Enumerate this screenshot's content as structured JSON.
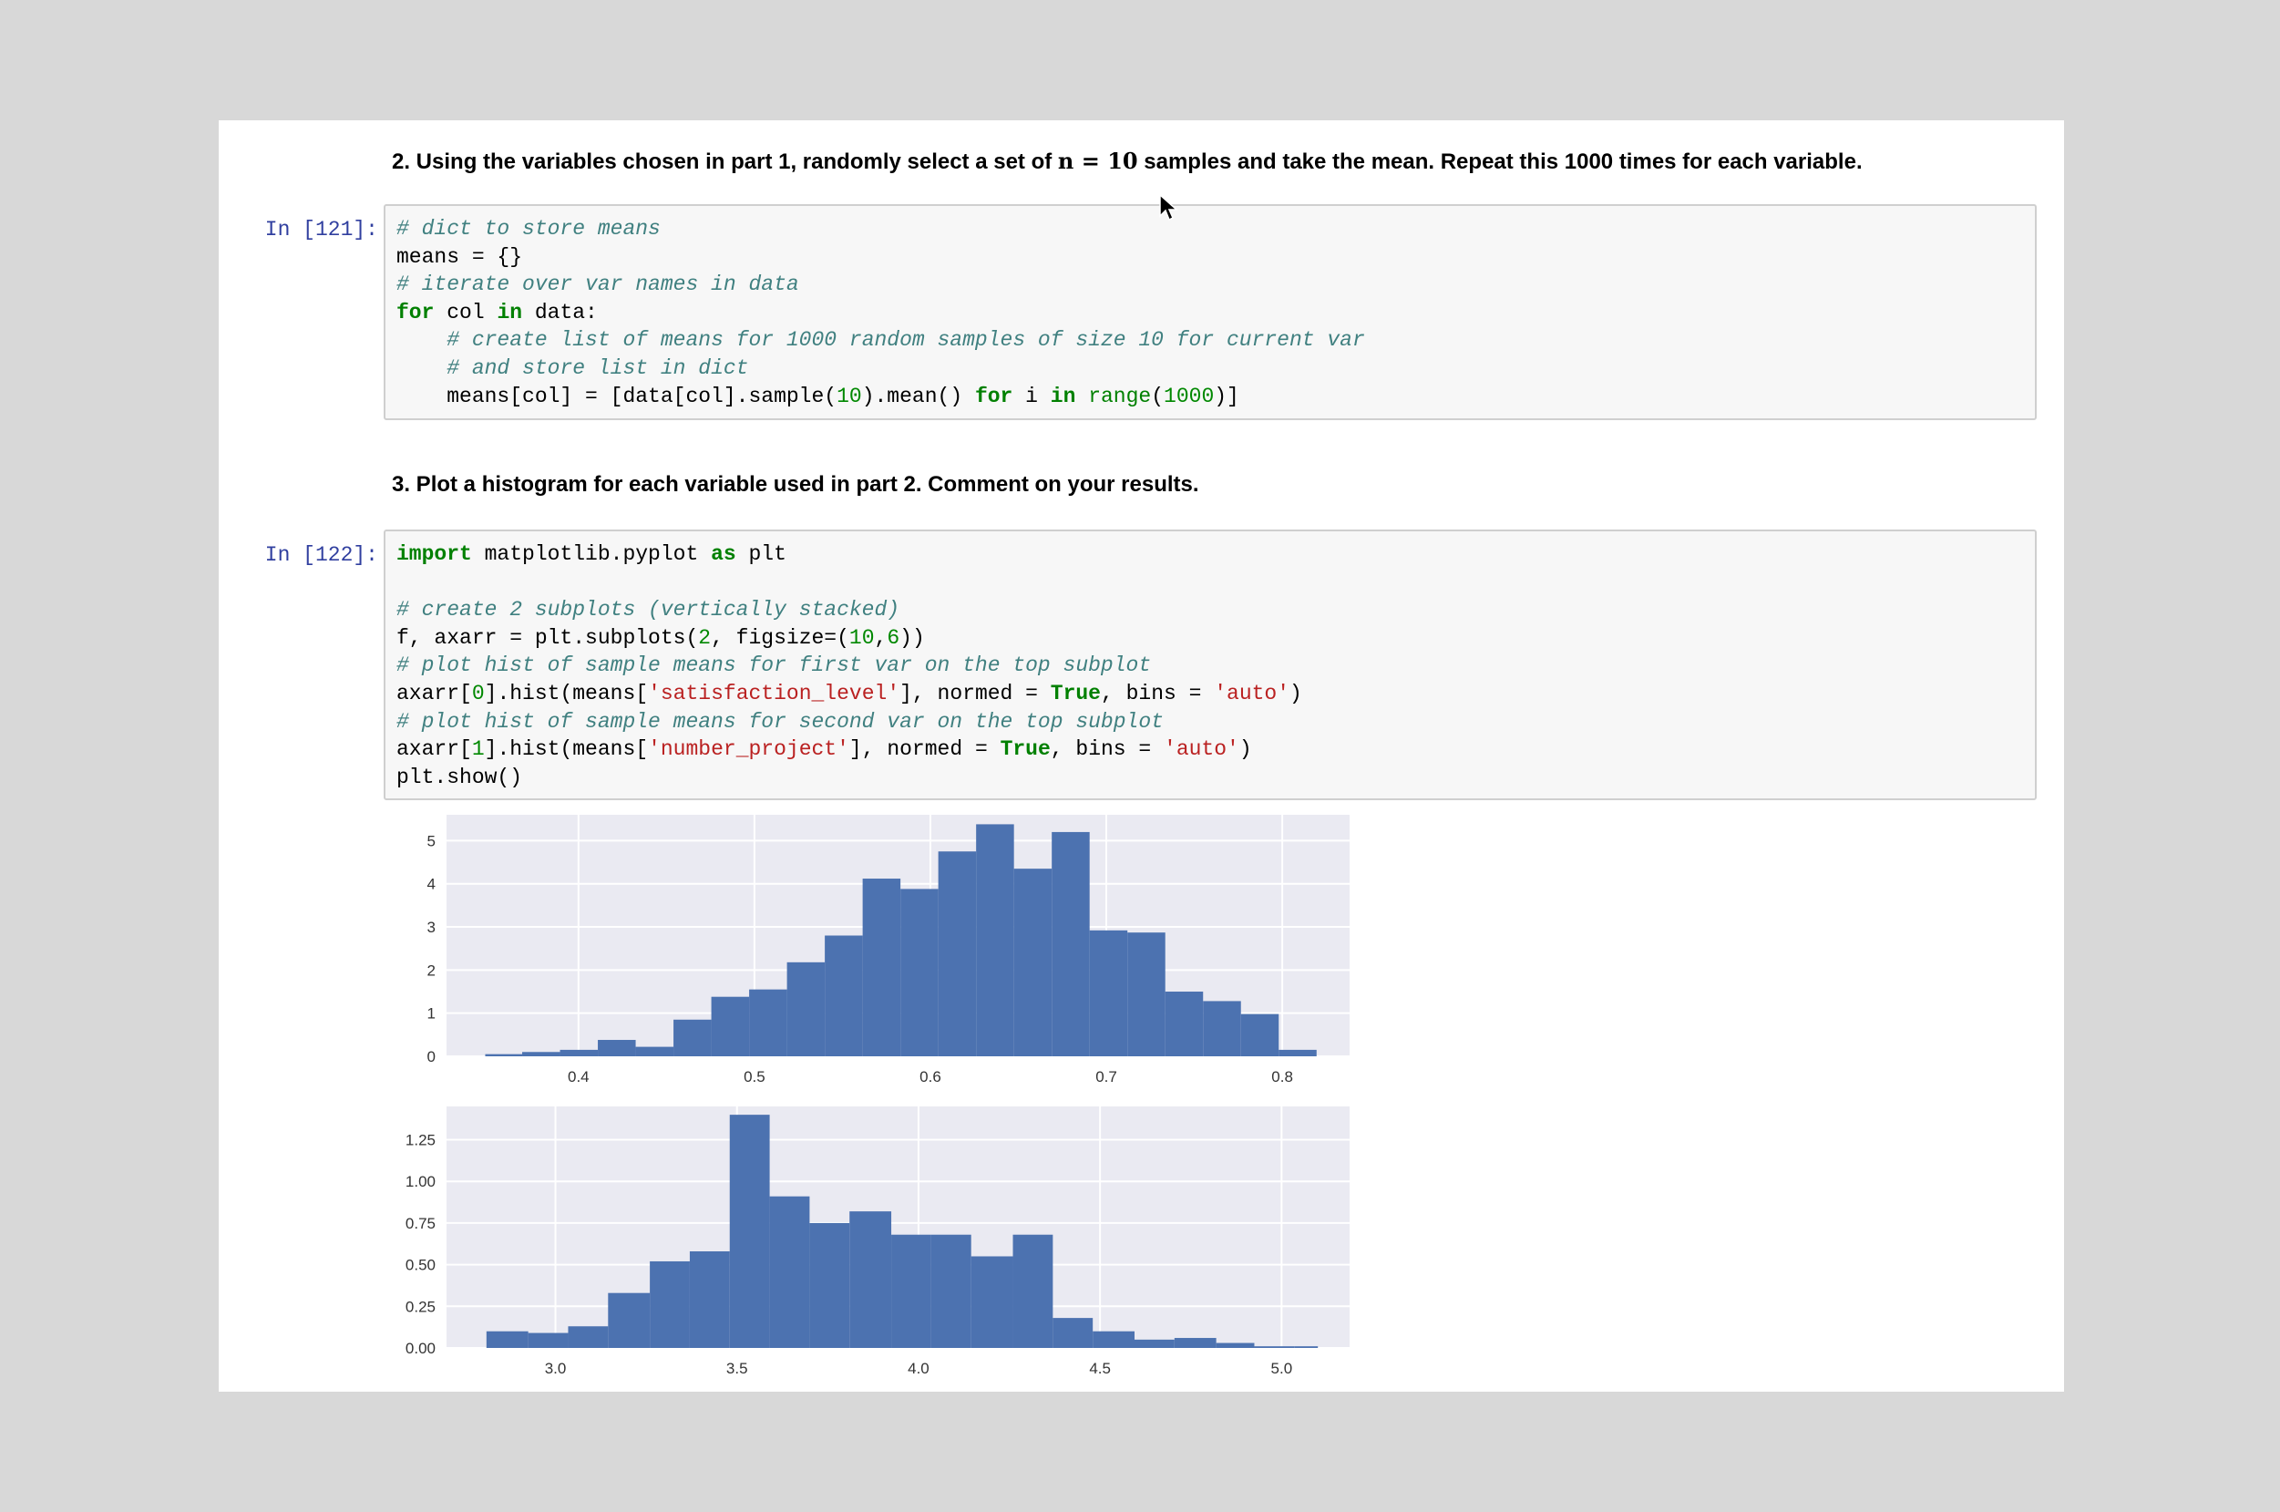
{
  "cells": {
    "md1": {
      "prefix": "2. Using the variables chosen in part 1, randomly select a set of ",
      "math": "n  =  10",
      "suffix": " samples and take the mean. Repeat this 1000 times for each variable."
    },
    "code1": {
      "prompt": "In [121]:",
      "lines": [
        [
          {
            "t": "# dict to store means",
            "c": "cm"
          }
        ],
        [
          {
            "t": "means = {}",
            "c": ""
          }
        ],
        [
          {
            "t": "# iterate over var names in data",
            "c": "cm"
          }
        ],
        [
          {
            "t": "for",
            "c": "kw"
          },
          {
            "t": " col ",
            "c": ""
          },
          {
            "t": "in",
            "c": "kw"
          },
          {
            "t": " data:",
            "c": ""
          }
        ],
        [
          {
            "t": "    ",
            "c": ""
          },
          {
            "t": "# create list of means for 1000 random samples of size 10 for current var",
            "c": "cm"
          }
        ],
        [
          {
            "t": "    ",
            "c": ""
          },
          {
            "t": "# and store list in dict",
            "c": "cm"
          }
        ],
        [
          {
            "t": "    means[col] = [data[col].sample(",
            "c": ""
          },
          {
            "t": "10",
            "c": "num"
          },
          {
            "t": ").mean() ",
            "c": ""
          },
          {
            "t": "for",
            "c": "kw"
          },
          {
            "t": " i ",
            "c": ""
          },
          {
            "t": "in",
            "c": "kw"
          },
          {
            "t": " ",
            "c": ""
          },
          {
            "t": "range",
            "c": "fn"
          },
          {
            "t": "(",
            "c": ""
          },
          {
            "t": "1000",
            "c": "num"
          },
          {
            "t": ")]",
            "c": ""
          }
        ]
      ]
    },
    "md2": {
      "text": "3. Plot a histogram for each variable used in part 2. Comment on your results."
    },
    "code2": {
      "prompt": "In [122]:",
      "lines": [
        [
          {
            "t": "import",
            "c": "kw"
          },
          {
            "t": " matplotlib.pyplot ",
            "c": ""
          },
          {
            "t": "as",
            "c": "kw"
          },
          {
            "t": " plt",
            "c": ""
          }
        ],
        [
          {
            "t": "",
            "c": ""
          }
        ],
        [
          {
            "t": "# create 2 subplots (vertically stacked)",
            "c": "cm"
          }
        ],
        [
          {
            "t": "f, axarr = plt.subplots(",
            "c": ""
          },
          {
            "t": "2",
            "c": "num"
          },
          {
            "t": ", figsize=(",
            "c": ""
          },
          {
            "t": "10",
            "c": "num"
          },
          {
            "t": ",",
            "c": ""
          },
          {
            "t": "6",
            "c": "num"
          },
          {
            "t": "))",
            "c": ""
          }
        ],
        [
          {
            "t": "# plot hist of sample means for first var on the top subplot",
            "c": "cm"
          }
        ],
        [
          {
            "t": "axarr[",
            "c": ""
          },
          {
            "t": "0",
            "c": "num"
          },
          {
            "t": "].hist(means[",
            "c": ""
          },
          {
            "t": "'satisfaction_level'",
            "c": "str"
          },
          {
            "t": "], normed = ",
            "c": ""
          },
          {
            "t": "True",
            "c": "kw"
          },
          {
            "t": ", bins = ",
            "c": ""
          },
          {
            "t": "'auto'",
            "c": "str"
          },
          {
            "t": ")",
            "c": ""
          }
        ],
        [
          {
            "t": "# plot hist of sample means for second var on the top subplot",
            "c": "cm"
          }
        ],
        [
          {
            "t": "axarr[",
            "c": ""
          },
          {
            "t": "1",
            "c": "num"
          },
          {
            "t": "].hist(means[",
            "c": ""
          },
          {
            "t": "'number_project'",
            "c": "str"
          },
          {
            "t": "], normed = ",
            "c": ""
          },
          {
            "t": "True",
            "c": "kw"
          },
          {
            "t": ", bins = ",
            "c": ""
          },
          {
            "t": "'auto'",
            "c": "str"
          },
          {
            "t": ")",
            "c": ""
          }
        ],
        [
          {
            "t": "plt.show()",
            "c": ""
          }
        ]
      ]
    }
  },
  "colors": {
    "bar": "#4c72b0",
    "plot_bg": "#eaeaf2",
    "grid": "#ffffff"
  },
  "chart_data": [
    {
      "type": "bar",
      "xlim": [
        0.325,
        0.845
      ],
      "ylim": [
        0,
        5.6
      ],
      "xticks": [
        0.4,
        0.5,
        0.6,
        0.7,
        0.8
      ],
      "xtick_labels": [
        "0.4",
        "0.5",
        "0.6",
        "0.7",
        "0.8"
      ],
      "yticks": [
        0,
        1,
        2,
        3,
        4,
        5
      ],
      "ytick_labels": [
        "0",
        "1",
        "2",
        "3",
        "4",
        "5"
      ],
      "bin_edges": [
        0.347,
        0.368,
        0.3895,
        0.411,
        0.4325,
        0.454,
        0.4755,
        0.497,
        0.5185,
        0.54,
        0.5615,
        0.583,
        0.6045,
        0.626,
        0.6475,
        0.669,
        0.6905,
        0.712,
        0.7335,
        0.755,
        0.7765,
        0.798,
        0.8195
      ],
      "values": [
        0.05,
        0.1,
        0.15,
        0.38,
        0.22,
        0.85,
        1.38,
        1.55,
        2.18,
        2.8,
        4.12,
        3.88,
        4.75,
        5.38,
        4.35,
        5.2,
        2.92,
        2.87,
        1.5,
        1.28,
        0.98,
        0.15
      ],
      "grid": true
    },
    {
      "type": "bar",
      "xlim": [
        2.7,
        5.22
      ],
      "ylim": [
        0,
        1.45
      ],
      "xticks": [
        3.0,
        3.5,
        4.0,
        4.5,
        5.0
      ],
      "xtick_labels": [
        "3.0",
        "3.5",
        "4.0",
        "4.5",
        "5.0"
      ],
      "yticks": [
        0,
        0.25,
        0.5,
        0.75,
        1.0,
        1.25
      ],
      "ytick_labels": [
        "0.00",
        "0.25",
        "0.50",
        "0.75",
        "1.00",
        "1.25"
      ],
      "bin_edges": [
        2.81,
        2.925,
        3.035,
        3.145,
        3.26,
        3.37,
        3.48,
        3.59,
        3.7,
        3.81,
        3.925,
        4.035,
        4.145,
        4.26,
        4.37,
        4.48,
        4.595,
        4.705,
        4.82,
        4.925,
        5.035,
        5.1
      ],
      "values": [
        0.1,
        0.09,
        0.13,
        0.33,
        0.52,
        0.58,
        1.4,
        0.91,
        0.75,
        0.82,
        0.68,
        0.68,
        0.55,
        0.68,
        0.18,
        0.1,
        0.05,
        0.06,
        0.03,
        0.01,
        0.01
      ],
      "grid": true
    }
  ]
}
